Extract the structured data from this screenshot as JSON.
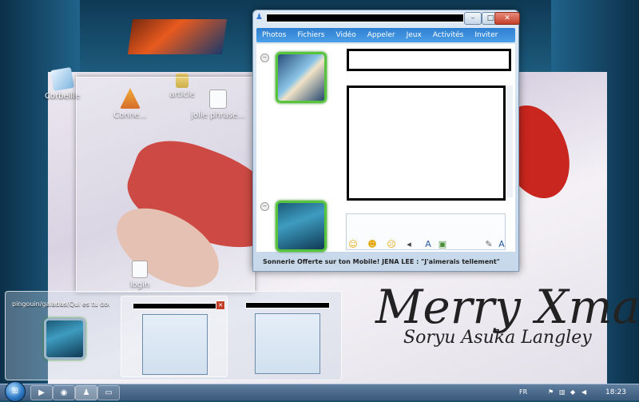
{
  "desktop": {
    "background_text": {
      "line1": "Merry Xmas",
      "line2": "Soryu Asuka Langley"
    },
    "icons": [
      {
        "label": "Corbeille",
        "icon": "recycle-bin-icon"
      },
      {
        "label": "Conne...",
        "icon": "vlc-icon"
      },
      {
        "label": "article",
        "icon": "folder-icon"
      },
      {
        "label": "jolie phrase...",
        "icon": "document-icon"
      },
      {
        "label": "login",
        "icon": "document-icon"
      }
    ]
  },
  "messenger": {
    "menu": [
      "Photos",
      "Fichiers",
      "Vidéo",
      "Appeler",
      "Jeux",
      "Activités",
      "Inviter"
    ],
    "more": "»",
    "window_buttons": {
      "minimize": "–",
      "maximize": "□",
      "close": "✕"
    },
    "toolbar_icons": [
      "smile-icon",
      "wink-icon",
      "nudge-icon",
      "font-icon",
      "background-icon"
    ],
    "status_line": "Sonnerie Offerte sur ton Mobile! JENA LEE : \"J'aimerais tellement\""
  },
  "thumbnails": [
    {
      "label": "pingouin/galadas(Qui es tu dou..."
    },
    {
      "label": ""
    },
    {
      "label": ""
    }
  ],
  "taskbar": {
    "start": "⊞",
    "buttons": [
      "media-icon",
      "firefox-icon",
      "messenger-icon",
      "explorer-icon"
    ],
    "language": "FR",
    "clock": "18:23"
  },
  "colors": {
    "accent": "#3b8fdc",
    "avatar_border": "#58c43c",
    "taskbar": "#3a5878"
  }
}
